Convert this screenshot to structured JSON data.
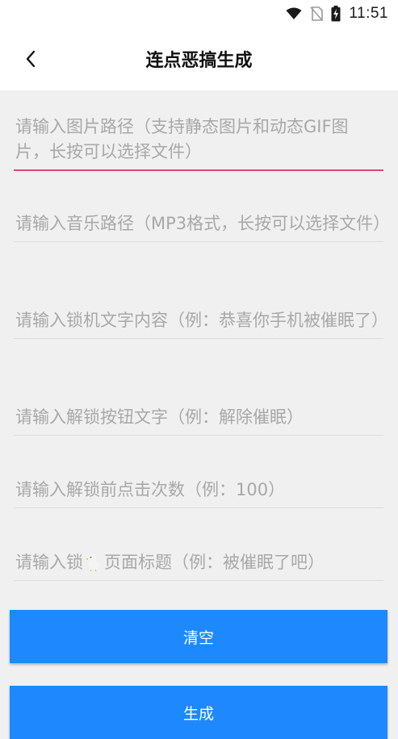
{
  "status_bar": {
    "time": "11:51",
    "icons": [
      "wifi-icon",
      "no-sim-icon",
      "battery-charging-icon"
    ]
  },
  "toolbar": {
    "title": "连点恶搞生成",
    "back_icon": "chevron-left-icon"
  },
  "form": {
    "image_path_placeholder": "请输入图片路径（支持静态图片和动态GIF图片，长按可以选择文件）",
    "music_path_placeholder": "请输入音乐路径（MP3格式，长按可以选择文件）",
    "lock_text_placeholder": "请输入锁机文字内容（例：恭喜你手机被催眠了）",
    "unlock_button_text_placeholder": "请输入解锁按钮文字（例：解除催眠）",
    "unlock_clicks_placeholder": "请输入解锁前点击次数（例：100）",
    "lock_page_title_placeholder_before": "请输入锁",
    "lock_page_title_placeholder_after": "页面标题（例：被催眠了吧）"
  },
  "buttons": {
    "clear_label": "清空",
    "generate_label": "生成"
  },
  "colors": {
    "accent_pink": "#e0457b",
    "button_blue": "#1e88ff"
  }
}
